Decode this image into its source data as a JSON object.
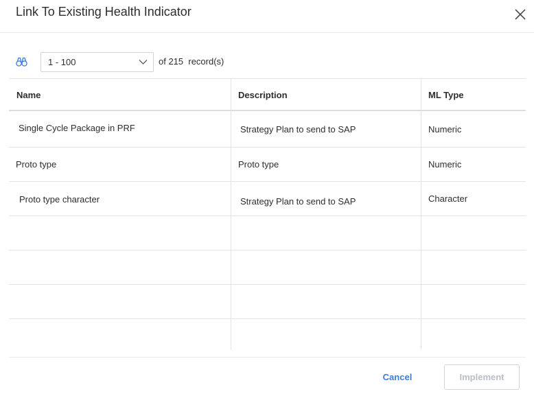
{
  "dialog": {
    "title": "Link To Existing Health Indicator",
    "close_icon": "close-icon"
  },
  "toolbar": {
    "search_icon": "binoculars-icon",
    "range_value": "1 - 100",
    "range_chevron_icon": "chevron-down-icon",
    "records_text": "of 215  record(s)"
  },
  "grid": {
    "columns": [
      "Name",
      "Description",
      "ML Type"
    ],
    "rows": [
      {
        "name": "Single Cycle Package in PRF",
        "description": "Strategy Plan to send to SAP",
        "ml_type": "Numeric"
      },
      {
        "name": "Proto type",
        "description": "Proto type",
        "ml_type": "Numeric"
      },
      {
        "name": "Proto type character",
        "description": "Strategy Plan to send to SAP",
        "ml_type": "Character"
      }
    ]
  },
  "footer": {
    "cancel_label": "Cancel",
    "implement_label": "Implement"
  },
  "colors": {
    "accent": "#3d7bd9",
    "border": "#e3e3e3",
    "disabled_text": "#b9bec4"
  }
}
